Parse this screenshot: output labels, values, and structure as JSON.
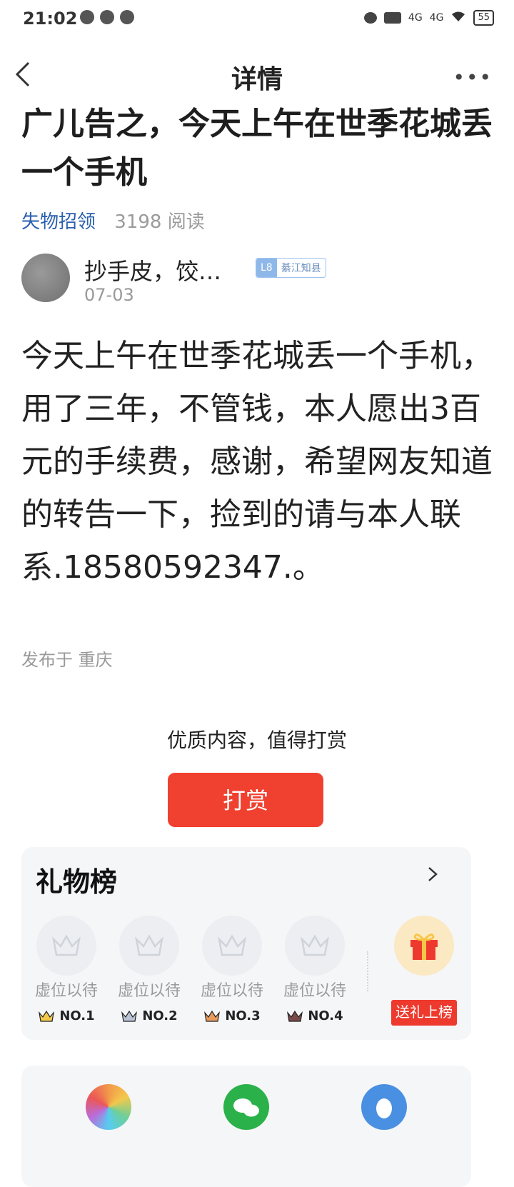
{
  "status": {
    "time": "21:02",
    "battery": "55",
    "network": [
      "4G",
      "4G"
    ]
  },
  "nav": {
    "title": "详情"
  },
  "post": {
    "title": "广儿告之，今天上午在世季花城丢一个手机",
    "category": "失物招领",
    "read_count": "3198 阅读",
    "author": {
      "name": "抄手皮，饺…",
      "level": "L8",
      "level_title": "綦江知县",
      "date": "07-03"
    },
    "body": "今天上午在世季花城丢一个手机，用了三年，不管钱，本人愿出3百元的手续费，感谢，希望网友知道的转告一下，捡到的请与本人联系.18580592347.。",
    "location": "发布于 重庆"
  },
  "tip": {
    "prompt": "优质内容，值得打赏",
    "button_label": "打赏"
  },
  "gift_board": {
    "title": "礼物榜",
    "slots": [
      {
        "text": "虚位以待",
        "rank": "NO.1",
        "crown_color": "#f2c94c"
      },
      {
        "text": "虚位以待",
        "rank": "NO.2",
        "crown_color": "#b9c3d4"
      },
      {
        "text": "虚位以待",
        "rank": "NO.3",
        "crown_color": "#e79b5e"
      },
      {
        "text": "虚位以待",
        "rank": "NO.4",
        "crown_color": "#7a4a4a"
      }
    ],
    "send_button": "送礼上榜"
  },
  "share": {
    "icons": [
      "moments-icon",
      "wechat-icon",
      "qq-icon"
    ]
  },
  "colors": {
    "accent": "#f0402f",
    "category": "#2a5fae"
  }
}
